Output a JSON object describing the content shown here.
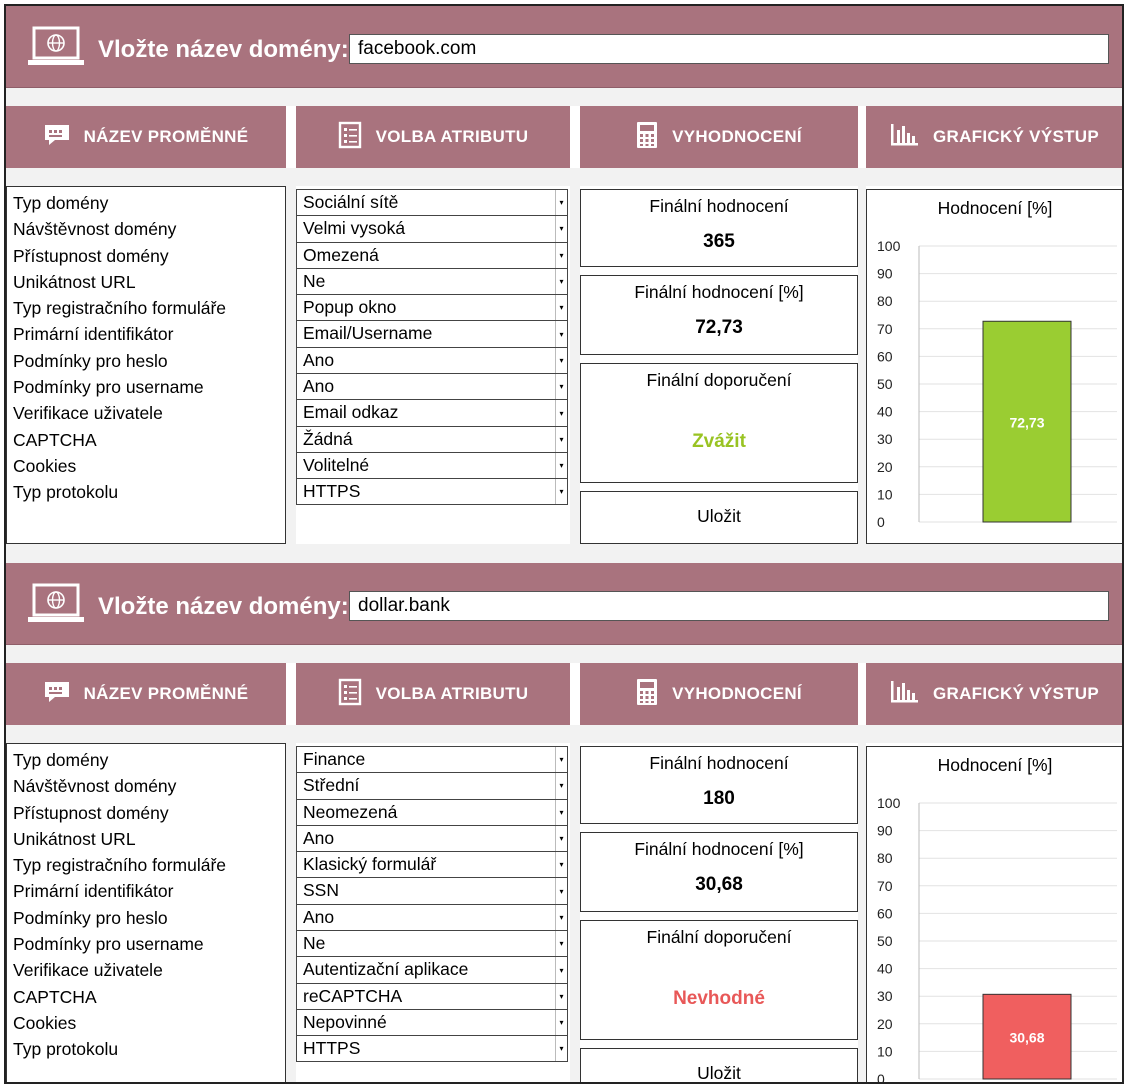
{
  "colors": {
    "header": "#a9737e",
    "good_bar": "#9acd32",
    "bad_bar": "#f05f5f",
    "consider": "#99c322",
    "unsuitable": "#e85858"
  },
  "headers": {
    "variable_name": "NÁZEV PROMĚNNÉ",
    "attribute_choice": "VOLBA ATRIBUTU",
    "evaluation": "VYHODNOCENÍ",
    "graphic_output": "GRAFICKÝ VÝSTUP"
  },
  "domain_prompt": "Vložte název domény:",
  "variables": [
    "Typ domény",
    "Návštěvnost domény",
    "Přístupnost domény",
    "Unikátnost URL",
    "Typ registračního formuláře",
    "Primární identifikátor",
    "Podmínky pro heslo",
    "Podmínky pro username",
    "Verifikace uživatele",
    "CAPTCHA",
    "Cookies",
    "Typ protokolu"
  ],
  "eval_labels": {
    "final_score": "Finální hodnocení",
    "final_score_pct": "Finální hodnocení [%]",
    "final_recommendation": "Finální doporučení",
    "save": "Uložit"
  },
  "panels": [
    {
      "domain": "facebook.com",
      "attributes": [
        "Sociální sítě",
        "Velmi vysoká",
        "Omezená",
        "Ne",
        "Popup okno",
        "Email/Username",
        "Ano",
        "Ano",
        "Email odkaz",
        "Žádná",
        "Volitelné",
        "HTTPS"
      ],
      "score": "365",
      "score_pct": "72,73",
      "recommendation": "Zvážit",
      "recommendation_color": "#99c322",
      "chart_data": {
        "type": "bar",
        "title": "Hodnocení [%]",
        "categories": [
          ""
        ],
        "values": [
          72.73
        ],
        "data_label": "72,73",
        "ylim": [
          0,
          100
        ],
        "yticks": [
          "100",
          "90",
          "80",
          "70",
          "60",
          "50",
          "40",
          "30",
          "20",
          "10",
          "0"
        ],
        "bar_color": "#9acd32",
        "grid": true
      }
    },
    {
      "domain": "dollar.bank",
      "attributes": [
        "Finance",
        "Střední",
        "Neomezená",
        "Ano",
        "Klasický formulář",
        "SSN",
        "Ano",
        "Ne",
        "Autentizační aplikace",
        "reCAPTCHA",
        "Nepovinné",
        "HTTPS"
      ],
      "score": "180",
      "score_pct": "30,68",
      "recommendation": "Nevhodné",
      "recommendation_color": "#e85858",
      "chart_data": {
        "type": "bar",
        "title": "Hodnocení [%]",
        "categories": [
          ""
        ],
        "values": [
          30.68
        ],
        "data_label": "30,68",
        "ylim": [
          0,
          100
        ],
        "yticks": [
          "100",
          "90",
          "80",
          "70",
          "60",
          "50",
          "40",
          "30",
          "20",
          "10",
          "0"
        ],
        "bar_color": "#f05f5f",
        "grid": true
      }
    }
  ]
}
